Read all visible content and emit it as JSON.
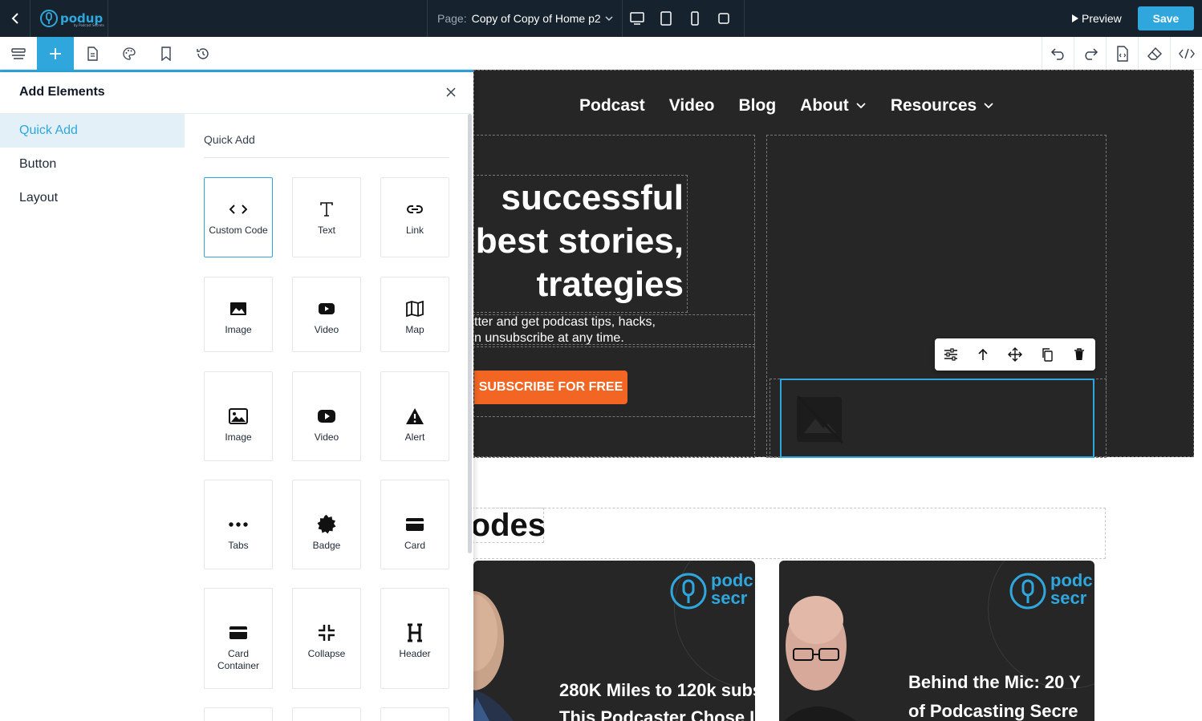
{
  "app": {
    "logo_text": "podup",
    "logo_subtext": "by Podcast Secrets",
    "page_label": "Page:",
    "page_name": "Copy of Copy of Home p2",
    "preview_label": "Preview",
    "save_label": "Save",
    "accent_color": "#2fa7dc",
    "topbar_color": "#16232f"
  },
  "panel": {
    "title": "Add Elements",
    "categories": [
      "Quick Add",
      "Button",
      "Layout"
    ],
    "active_category": "Quick Add",
    "section_label": "Quick Add",
    "elements": [
      {
        "label": "Custom Code",
        "icon": "code-icon",
        "selected": true
      },
      {
        "label": "Text",
        "icon": "text-icon"
      },
      {
        "label": "Link",
        "icon": "link-icon"
      },
      {
        "label": "Image",
        "icon": "image-icon"
      },
      {
        "label": "Video",
        "icon": "video-icon"
      },
      {
        "label": "Map",
        "icon": "map-icon"
      },
      {
        "label": "Image",
        "icon": "image-icon"
      },
      {
        "label": "Video",
        "icon": "video-icon"
      },
      {
        "label": "Alert",
        "icon": "alert-icon"
      },
      {
        "label": "Tabs",
        "icon": "tabs-icon"
      },
      {
        "label": "Badge",
        "icon": "badge-icon"
      },
      {
        "label": "Card",
        "icon": "card-icon"
      },
      {
        "label": "Card Container",
        "icon": "card-icon"
      },
      {
        "label": "Collapse",
        "icon": "collapse-icon"
      },
      {
        "label": "Header",
        "icon": "header-icon"
      }
    ]
  },
  "canvas": {
    "nav": [
      {
        "label": "Podcast",
        "dropdown": false
      },
      {
        "label": "Video",
        "dropdown": false
      },
      {
        "label": "Blog",
        "dropdown": false
      },
      {
        "label": "About",
        "dropdown": true
      },
      {
        "label": "Resources",
        "dropdown": true
      }
    ],
    "headline": [
      "successful",
      "r best stories,",
      "trategies"
    ],
    "subtext": [
      "tter and get podcast tips, hacks,",
      "n unsubscribe at any time."
    ],
    "cta_label": "SUBSCRIBE FOR FREE",
    "cta_color": "#f26522",
    "episodes_title": "odes",
    "cards": [
      {
        "brand": "podc secr",
        "brand_top": "podc",
        "brand_bottom": "secr",
        "title_line1": "280K Miles to 120k subs",
        "title_line2": "This Podcaster Chose L"
      },
      {
        "brand": "podc secr",
        "brand_top": "podc",
        "brand_bottom": "secr",
        "title_line1": "Behind the Mic: 20 Y",
        "title_line2": "of Podcasting Secre"
      }
    ]
  }
}
